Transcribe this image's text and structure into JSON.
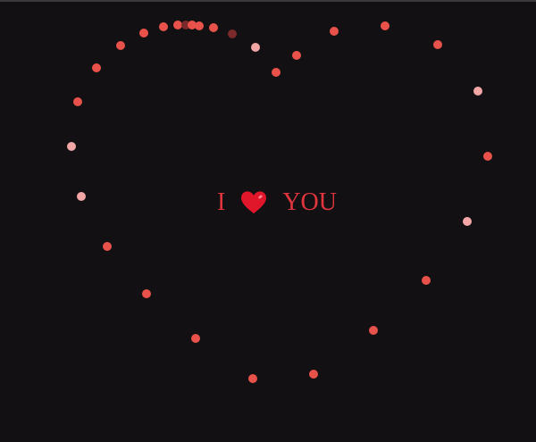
{
  "message": {
    "left_word": "I",
    "right_word": "YOU",
    "icon": "heart-icon"
  },
  "colors": {
    "background": "#121012",
    "text": "#e0353d",
    "dot_red": "#e9524a",
    "dot_pink": "#f2a6a6",
    "dot_dim": "#7a2a2a",
    "heart_fill": "#e0162b",
    "heart_shine": "#ff8a95"
  }
}
